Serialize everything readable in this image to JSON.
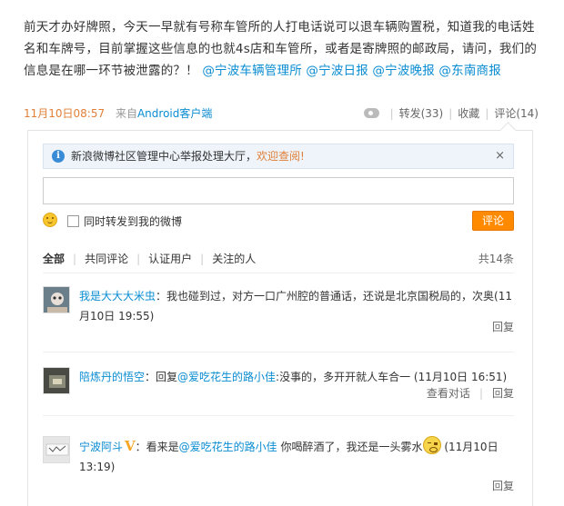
{
  "post": {
    "text": "前天才办好牌照，今天一早就有号称车管所的人打电话说可以退车辆购置税，知道我的电话姓名和车牌号，目前掌握这些信息的也就4s店和车管所，或者是寄牌照的邮政局，请问，我们的信息是在哪一环节被泄露的？！",
    "mentions": [
      "@宁波车辆管理所",
      "@宁波日报",
      "@宁波晚报",
      "@东南商报"
    ],
    "time": "11月10日08:57",
    "source_prefix": "来自",
    "source": "Android客户端",
    "repost_label": "转发(33)",
    "favorite_label": "收藏",
    "comment_label": "评论(14)"
  },
  "notice": {
    "text": "新浪微博社区管理中心举报处理大厅，",
    "link": "欢迎查阅!",
    "close": "×"
  },
  "composer": {
    "repost_label": "同时转发到我的微博",
    "submit_label": "评论"
  },
  "filter": {
    "tabs": [
      "全部",
      "共同评论",
      "认证用户",
      "关注的人"
    ],
    "count": "共14条"
  },
  "comments": [
    {
      "user": "我是大大大米虫",
      "text": "：我也碰到过，对方一口广州腔的普通话，还说是北京国税局的，次奥",
      "time": "(11月10日 19:55)",
      "reply": "回复"
    },
    {
      "user": "陪炼丹的悟空",
      "prefix": "：回复",
      "mention": "@爱吃花生的路小佳",
      "text": ":没事的，多开开就人车合一",
      "time": "(11月10日 16:51)",
      "view_conversation": "查看对话",
      "reply": "回复"
    },
    {
      "user": "宁波阿斗",
      "vip": "V",
      "prefix": "：看来是",
      "mention": "@爱吃花生的路小佳",
      "text": " 你喝醉酒了，我还是一头雾水",
      "time": "(11月10日 13:19)",
      "reply": "回复"
    }
  ]
}
